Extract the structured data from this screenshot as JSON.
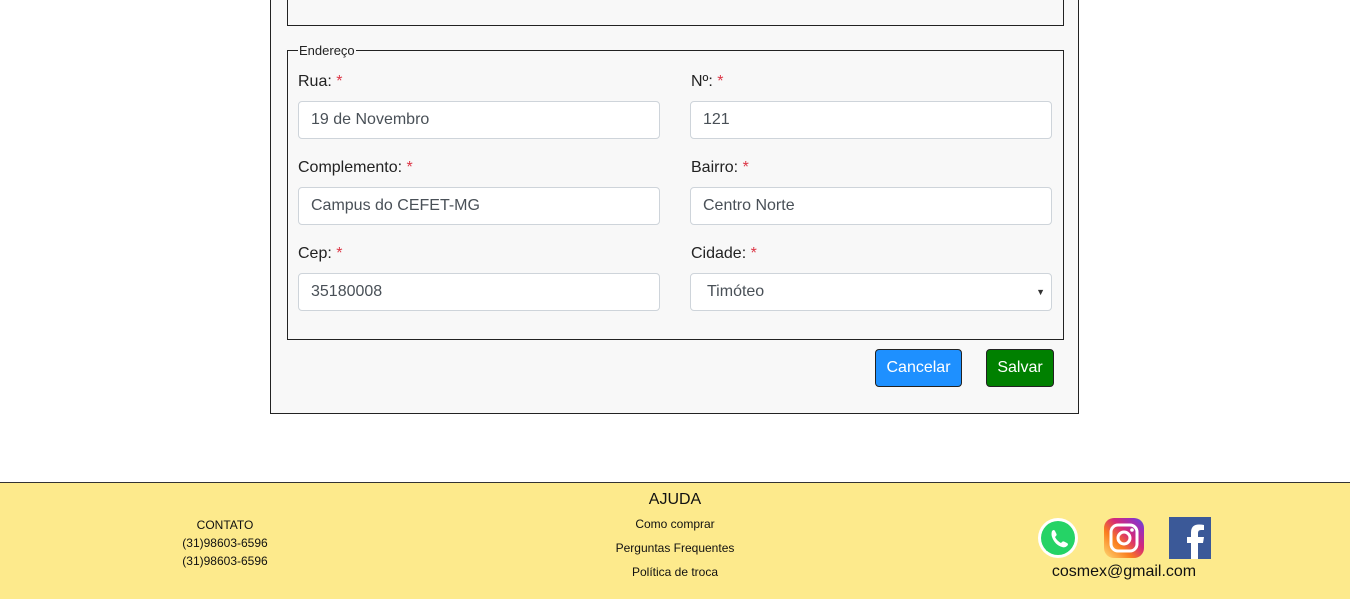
{
  "address": {
    "legend": "Endereço",
    "required_mark": "*",
    "fields": {
      "rua": {
        "label": "Rua:",
        "value": "19 de Novembro"
      },
      "numero": {
        "label": "Nº:",
        "value": "121"
      },
      "complemento": {
        "label": "Complemento:",
        "value": "Campus do CEFET-MG"
      },
      "bairro": {
        "label": "Bairro:",
        "value": "Centro Norte"
      },
      "cep": {
        "label": "Cep:",
        "value": "35180008"
      },
      "cidade": {
        "label": "Cidade:",
        "value": "Timóteo"
      }
    }
  },
  "actions": {
    "cancel_label": "Cancelar",
    "save_label": "Salvar"
  },
  "footer": {
    "contact": {
      "title": "CONTATO",
      "phone1": "(31)98603-6596",
      "phone2": "(31)98603-6596"
    },
    "help": {
      "title": "AJUDA",
      "links": [
        "Como comprar",
        "Perguntas Frequentes",
        "Política de troca"
      ]
    },
    "social": {
      "icons": [
        "whatsapp-icon",
        "instagram-icon",
        "facebook-icon"
      ],
      "email": "cosmex@gmail.com"
    }
  },
  "colors": {
    "cancel_button": "#1e90ff",
    "save_button": "#008000",
    "footer_bg": "#fdea8c",
    "required": "#dc3545"
  }
}
